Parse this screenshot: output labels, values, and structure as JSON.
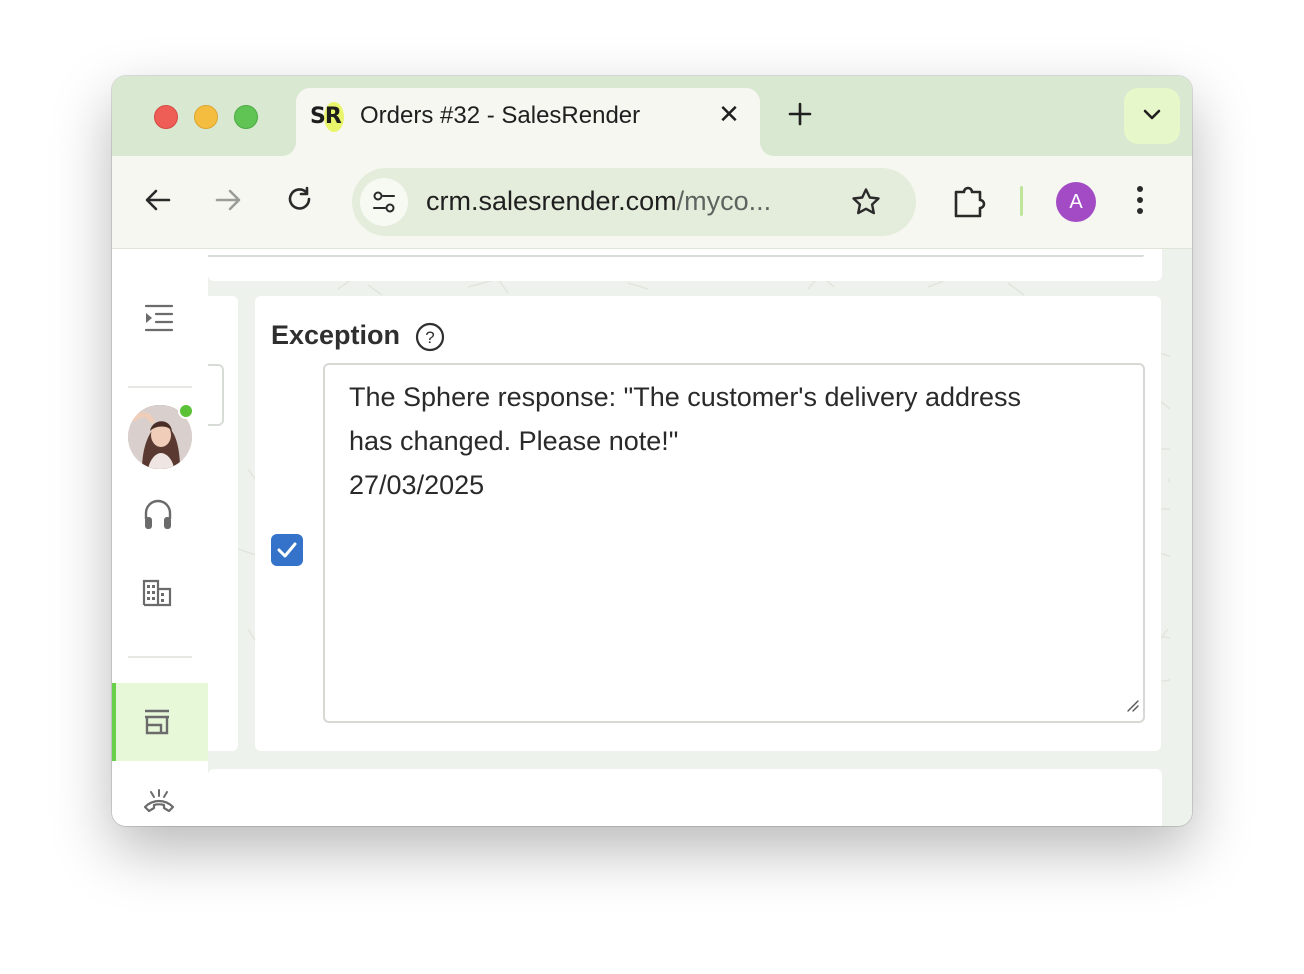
{
  "browser": {
    "tab": {
      "favicon_text": "SR",
      "title": "Orders #32 - SalesRender",
      "close_glyph": "✕"
    },
    "address_bar": {
      "url_host": "crm.salesrender.com",
      "url_path": "/myco..."
    },
    "profile_initial": "A",
    "icons": [
      "back-icon",
      "forward-icon",
      "reload-icon",
      "site-info-icon",
      "bookmark-star-icon",
      "extensions-icon",
      "kebab-menu-icon",
      "tab-search-chevron-icon",
      "new-tab-plus-icon"
    ]
  },
  "sidebar": {
    "items": [
      {
        "name": "collapse-menu",
        "icon": "menu-indent-icon"
      },
      {
        "name": "user-avatar",
        "icon": "avatar",
        "status": "online"
      },
      {
        "name": "support",
        "icon": "headset-icon"
      },
      {
        "name": "company",
        "icon": "building-icon"
      },
      {
        "name": "store",
        "icon": "storefront-icon",
        "active": true
      },
      {
        "name": "calls",
        "icon": "phone-hangup-icon"
      }
    ]
  },
  "form": {
    "exception": {
      "label": "Exception",
      "help_glyph": "?",
      "checked": true,
      "text_lines": [
        "The Sphere response: \"The customer's delivery address",
        "has changed. Please note!\"",
        "27/03/2025"
      ]
    }
  },
  "colors": {
    "tabbar_bg": "#d9e8d0",
    "accent_green": "#68d04a",
    "checkbox_blue": "#3473c9",
    "profile_purple": "#a24bc4"
  }
}
